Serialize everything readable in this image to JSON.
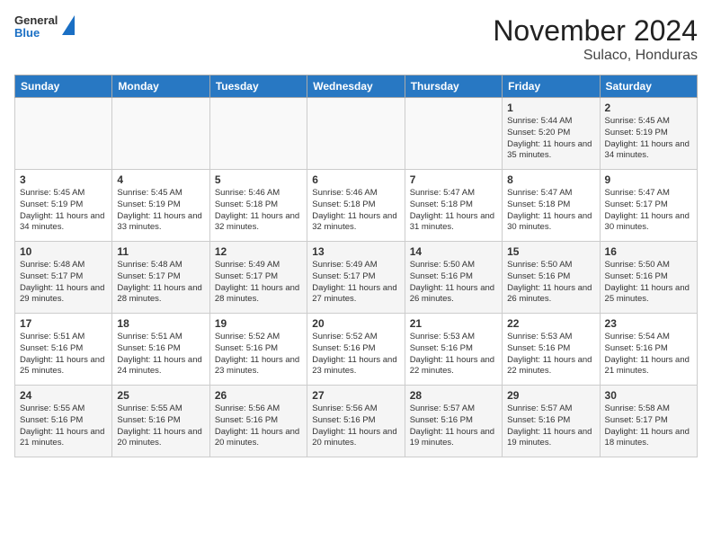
{
  "header": {
    "logo": {
      "general": "General",
      "blue": "Blue"
    },
    "title": "November 2024",
    "subtitle": "Sulaco, Honduras"
  },
  "days_of_week": [
    "Sunday",
    "Monday",
    "Tuesday",
    "Wednesday",
    "Thursday",
    "Friday",
    "Saturday"
  ],
  "weeks": [
    [
      {
        "day": "",
        "info": ""
      },
      {
        "day": "",
        "info": ""
      },
      {
        "day": "",
        "info": ""
      },
      {
        "day": "",
        "info": ""
      },
      {
        "day": "",
        "info": ""
      },
      {
        "day": "1",
        "info": "Sunrise: 5:44 AM\nSunset: 5:20 PM\nDaylight: 11 hours and 35 minutes."
      },
      {
        "day": "2",
        "info": "Sunrise: 5:45 AM\nSunset: 5:19 PM\nDaylight: 11 hours and 34 minutes."
      }
    ],
    [
      {
        "day": "3",
        "info": "Sunrise: 5:45 AM\nSunset: 5:19 PM\nDaylight: 11 hours and 34 minutes."
      },
      {
        "day": "4",
        "info": "Sunrise: 5:45 AM\nSunset: 5:19 PM\nDaylight: 11 hours and 33 minutes."
      },
      {
        "day": "5",
        "info": "Sunrise: 5:46 AM\nSunset: 5:18 PM\nDaylight: 11 hours and 32 minutes."
      },
      {
        "day": "6",
        "info": "Sunrise: 5:46 AM\nSunset: 5:18 PM\nDaylight: 11 hours and 32 minutes."
      },
      {
        "day": "7",
        "info": "Sunrise: 5:47 AM\nSunset: 5:18 PM\nDaylight: 11 hours and 31 minutes."
      },
      {
        "day": "8",
        "info": "Sunrise: 5:47 AM\nSunset: 5:18 PM\nDaylight: 11 hours and 30 minutes."
      },
      {
        "day": "9",
        "info": "Sunrise: 5:47 AM\nSunset: 5:17 PM\nDaylight: 11 hours and 30 minutes."
      }
    ],
    [
      {
        "day": "10",
        "info": "Sunrise: 5:48 AM\nSunset: 5:17 PM\nDaylight: 11 hours and 29 minutes."
      },
      {
        "day": "11",
        "info": "Sunrise: 5:48 AM\nSunset: 5:17 PM\nDaylight: 11 hours and 28 minutes."
      },
      {
        "day": "12",
        "info": "Sunrise: 5:49 AM\nSunset: 5:17 PM\nDaylight: 11 hours and 28 minutes."
      },
      {
        "day": "13",
        "info": "Sunrise: 5:49 AM\nSunset: 5:17 PM\nDaylight: 11 hours and 27 minutes."
      },
      {
        "day": "14",
        "info": "Sunrise: 5:50 AM\nSunset: 5:16 PM\nDaylight: 11 hours and 26 minutes."
      },
      {
        "day": "15",
        "info": "Sunrise: 5:50 AM\nSunset: 5:16 PM\nDaylight: 11 hours and 26 minutes."
      },
      {
        "day": "16",
        "info": "Sunrise: 5:50 AM\nSunset: 5:16 PM\nDaylight: 11 hours and 25 minutes."
      }
    ],
    [
      {
        "day": "17",
        "info": "Sunrise: 5:51 AM\nSunset: 5:16 PM\nDaylight: 11 hours and 25 minutes."
      },
      {
        "day": "18",
        "info": "Sunrise: 5:51 AM\nSunset: 5:16 PM\nDaylight: 11 hours and 24 minutes."
      },
      {
        "day": "19",
        "info": "Sunrise: 5:52 AM\nSunset: 5:16 PM\nDaylight: 11 hours and 23 minutes."
      },
      {
        "day": "20",
        "info": "Sunrise: 5:52 AM\nSunset: 5:16 PM\nDaylight: 11 hours and 23 minutes."
      },
      {
        "day": "21",
        "info": "Sunrise: 5:53 AM\nSunset: 5:16 PM\nDaylight: 11 hours and 22 minutes."
      },
      {
        "day": "22",
        "info": "Sunrise: 5:53 AM\nSunset: 5:16 PM\nDaylight: 11 hours and 22 minutes."
      },
      {
        "day": "23",
        "info": "Sunrise: 5:54 AM\nSunset: 5:16 PM\nDaylight: 11 hours and 21 minutes."
      }
    ],
    [
      {
        "day": "24",
        "info": "Sunrise: 5:55 AM\nSunset: 5:16 PM\nDaylight: 11 hours and 21 minutes."
      },
      {
        "day": "25",
        "info": "Sunrise: 5:55 AM\nSunset: 5:16 PM\nDaylight: 11 hours and 20 minutes."
      },
      {
        "day": "26",
        "info": "Sunrise: 5:56 AM\nSunset: 5:16 PM\nDaylight: 11 hours and 20 minutes."
      },
      {
        "day": "27",
        "info": "Sunrise: 5:56 AM\nSunset: 5:16 PM\nDaylight: 11 hours and 20 minutes."
      },
      {
        "day": "28",
        "info": "Sunrise: 5:57 AM\nSunset: 5:16 PM\nDaylight: 11 hours and 19 minutes."
      },
      {
        "day": "29",
        "info": "Sunrise: 5:57 AM\nSunset: 5:16 PM\nDaylight: 11 hours and 19 minutes."
      },
      {
        "day": "30",
        "info": "Sunrise: 5:58 AM\nSunset: 5:17 PM\nDaylight: 11 hours and 18 minutes."
      }
    ]
  ]
}
